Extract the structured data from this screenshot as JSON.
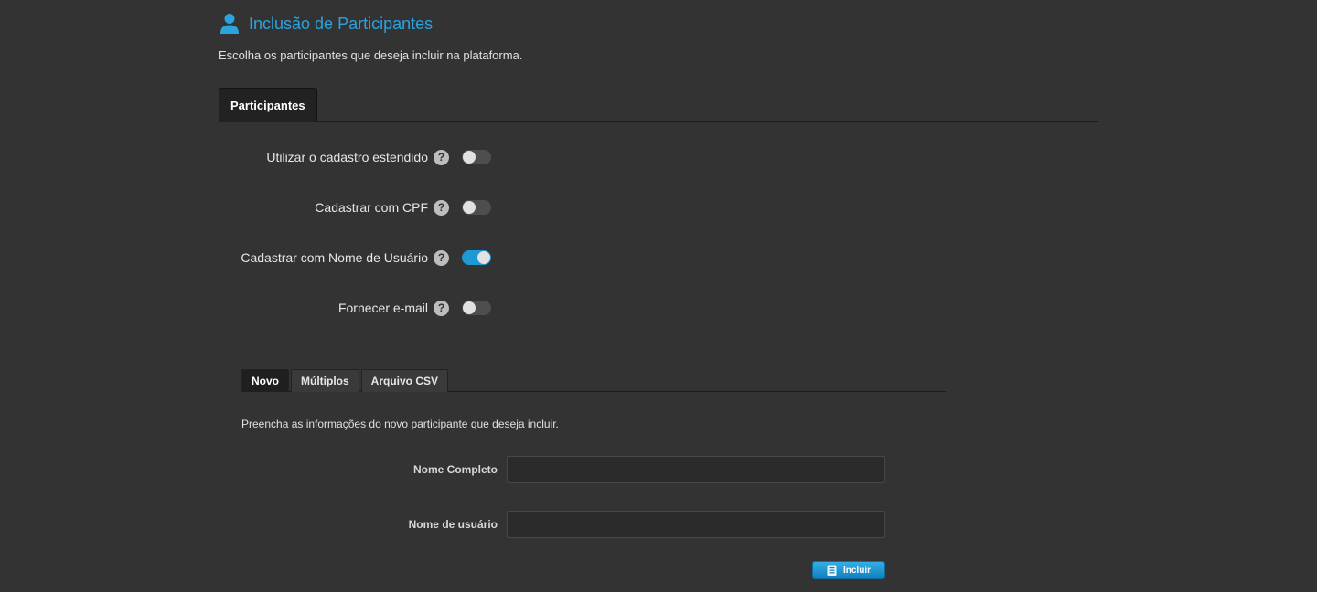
{
  "header": {
    "title": "Inclusão de Participantes",
    "icon": "user-icon",
    "accent_color": "#2aa3df"
  },
  "subtitle": "Escolha os participantes que deseja incluir na plataforma.",
  "main_tabs": [
    {
      "label": "Participantes",
      "active": true
    }
  ],
  "settings": [
    {
      "label": "Utilizar o cadastro estendido",
      "help_icon": "?",
      "enabled": false
    },
    {
      "label": "Cadastrar com CPF",
      "help_icon": "?",
      "enabled": false
    },
    {
      "label": "Cadastrar com Nome de Usuário",
      "help_icon": "?",
      "enabled": true
    },
    {
      "label": "Fornecer e-mail",
      "help_icon": "?",
      "enabled": false
    }
  ],
  "sub_tabs": [
    {
      "label": "Novo",
      "active": true
    },
    {
      "label": "Múltiplos",
      "active": false
    },
    {
      "label": "Arquivo CSV",
      "active": false
    }
  ],
  "form": {
    "description": "Preencha as informações do novo participante que deseja incluir.",
    "fields": [
      {
        "label": "Nome Completo",
        "value": "",
        "placeholder": ""
      },
      {
        "label": "Nome de usuário",
        "value": "",
        "placeholder": ""
      }
    ],
    "submit_label": "Incluir",
    "submit_icon": "document-icon",
    "button_color": "#1d9ad6"
  }
}
